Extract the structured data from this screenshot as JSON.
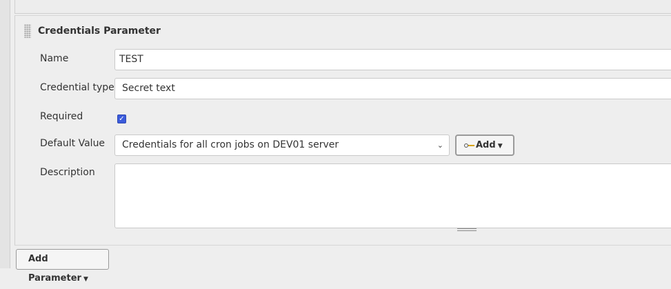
{
  "section": {
    "title": "Credentials Parameter",
    "fields": {
      "name_label": "Name",
      "name_value": "TEST",
      "credential_type_label": "Credential type",
      "credential_type_value": "Secret text",
      "required_label": "Required",
      "required_checked": true,
      "default_value_label": "Default Value",
      "default_value_selected": "Credentials for all cron jobs on DEV01 server",
      "add_button_label": "Add",
      "description_label": "Description",
      "description_value": ""
    }
  },
  "footer": {
    "add_parameter_label": "Add Parameter"
  },
  "icons": {
    "key": "key-icon",
    "caret": "caret-down-icon"
  }
}
